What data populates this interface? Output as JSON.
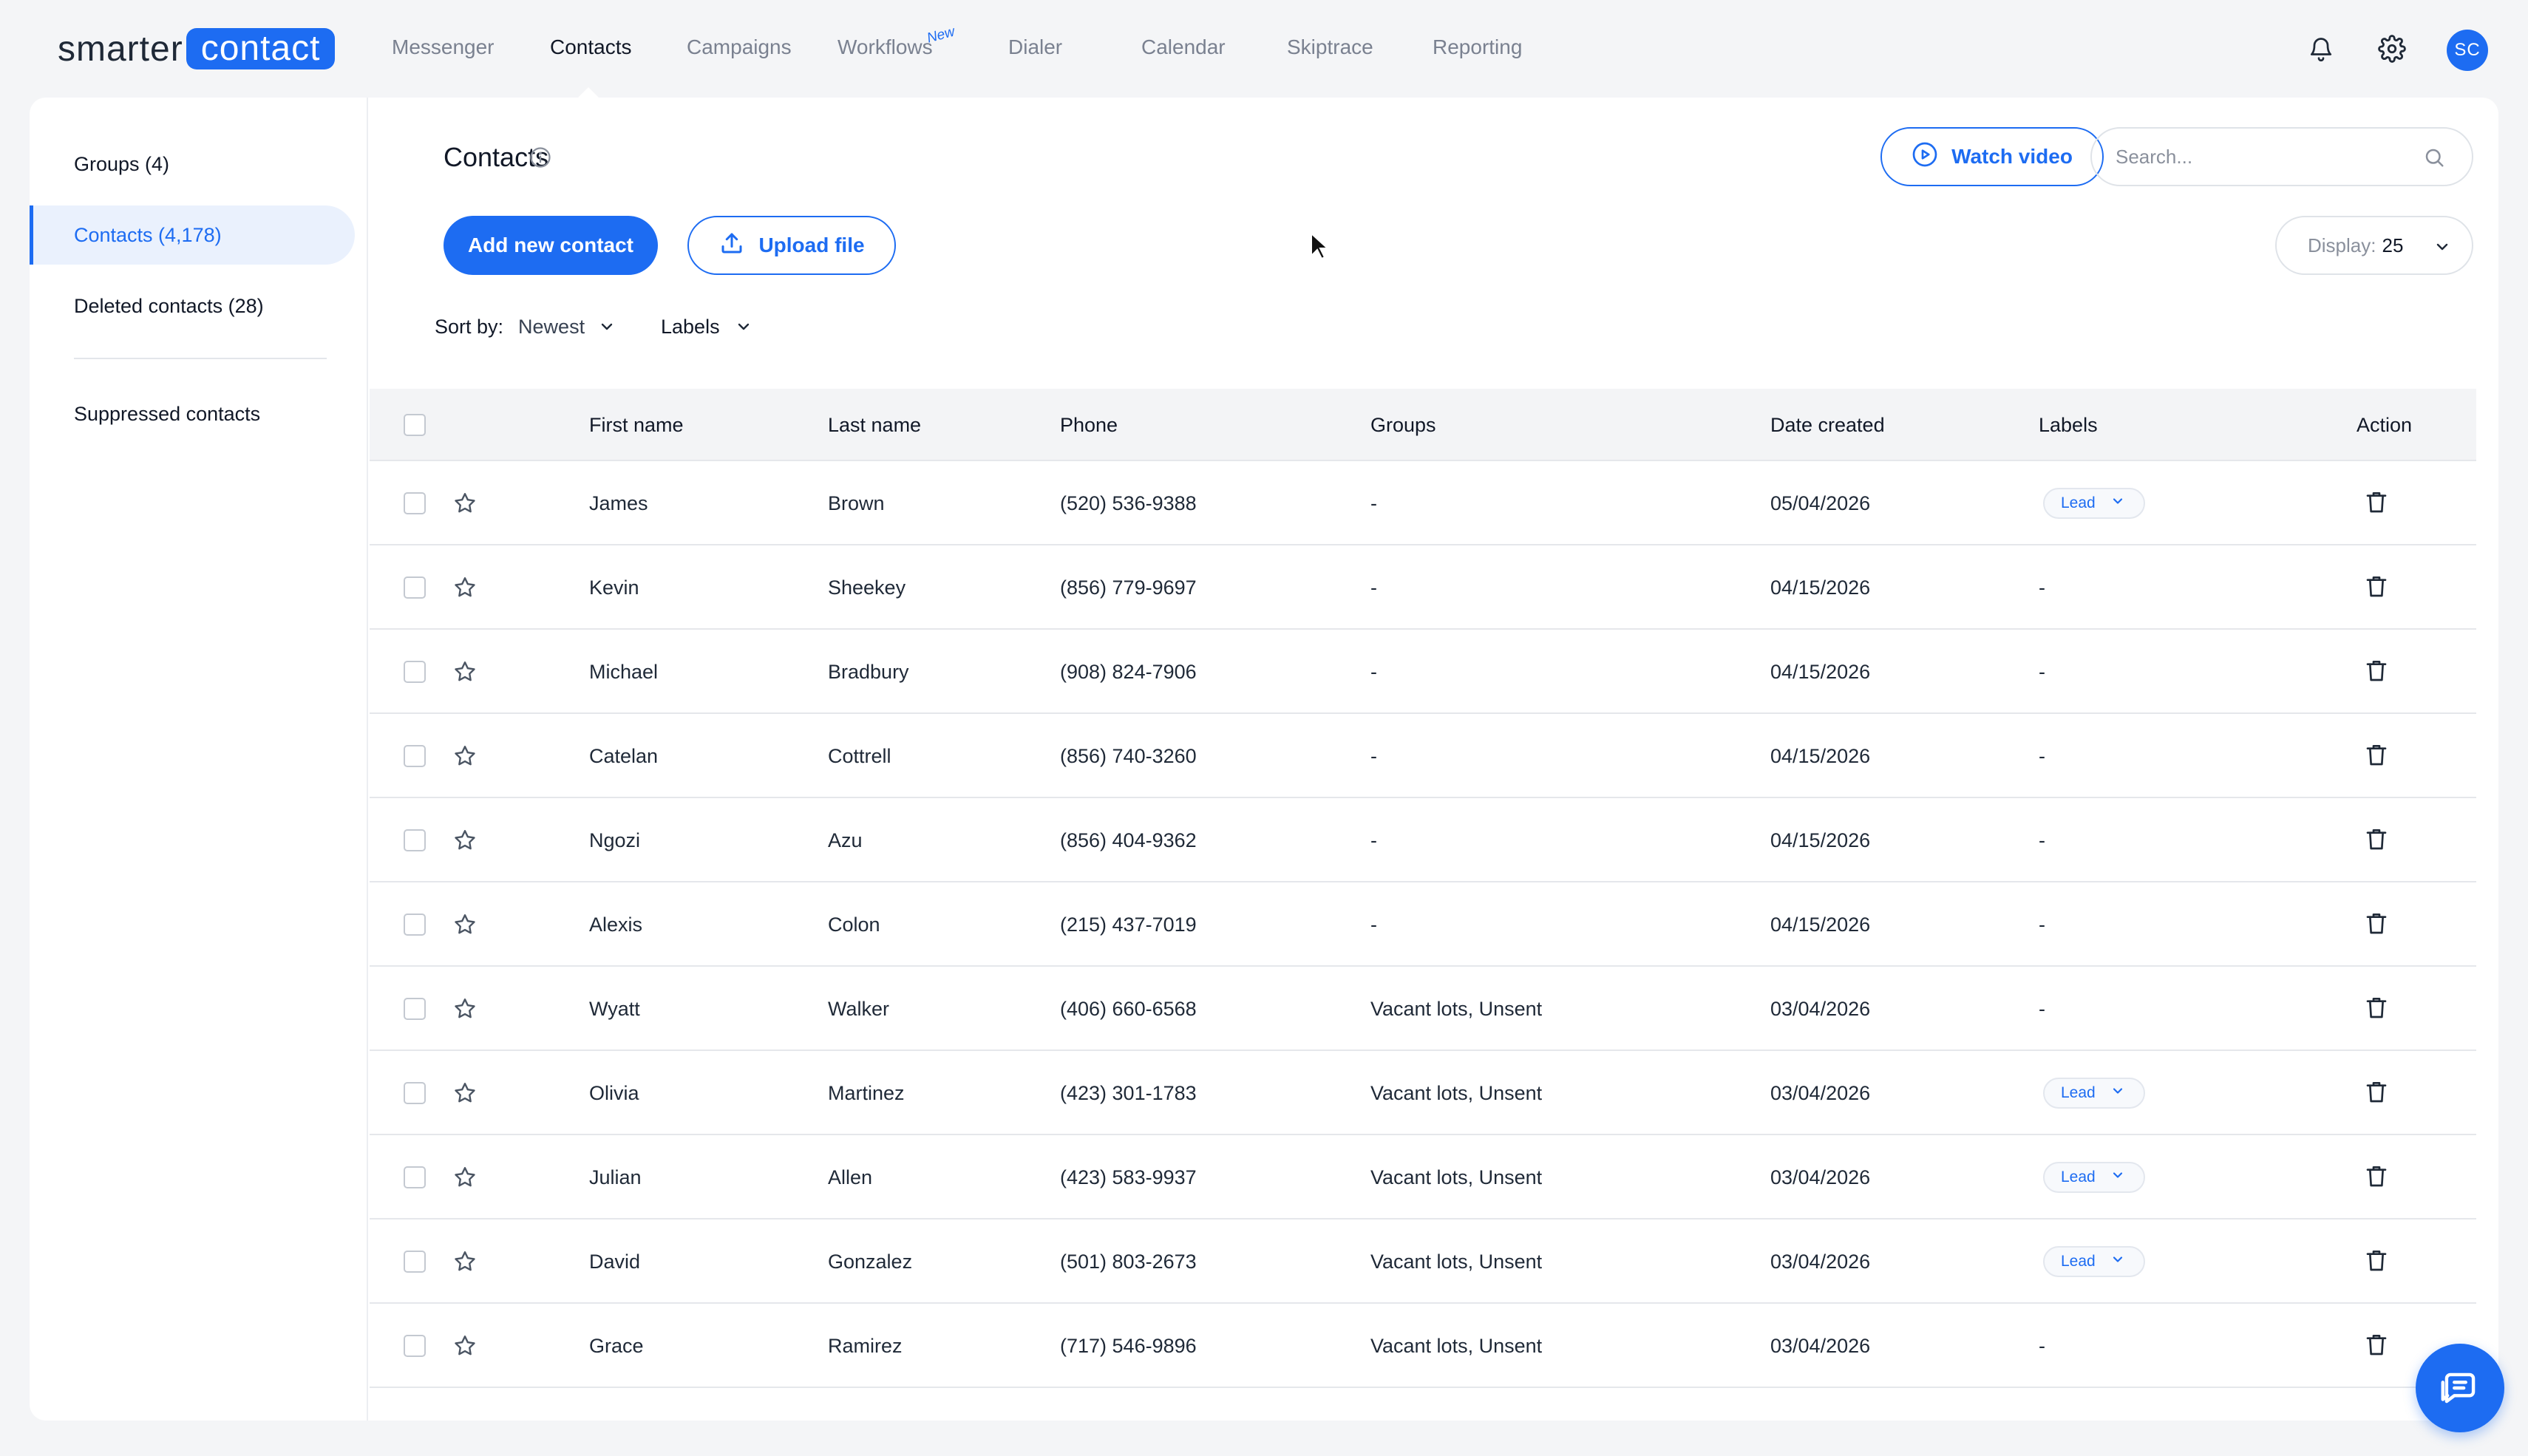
{
  "logo": {
    "part1": "smarter",
    "part2": "contact"
  },
  "nav": {
    "items": [
      "Messenger",
      "Contacts",
      "Campaigns",
      "Workflows",
      "Dialer",
      "Calendar",
      "Skiptrace",
      "Reporting"
    ],
    "active": "Contacts",
    "new_badge": "New"
  },
  "user": {
    "initials": "SC"
  },
  "sidebar": {
    "items": [
      {
        "label": "Groups (4)"
      },
      {
        "label": "Contacts (4,178)"
      },
      {
        "label": "Deleted contacts (28)"
      },
      {
        "label": "Suppressed contacts"
      }
    ],
    "active": "Contacts (4,178)"
  },
  "main": {
    "title": "Contacts",
    "watch_video": "Watch video",
    "search_placeholder": "Search...",
    "add_contact": "Add new contact",
    "upload_file": "Upload file",
    "display_label": "Display:",
    "display_value": "25",
    "sort_label": "Sort by:",
    "sort_value": "Newest",
    "labels_filter": "Labels"
  },
  "table": {
    "columns": [
      "First name",
      "Last name",
      "Phone",
      "Groups",
      "Date created",
      "Labels",
      "Action"
    ],
    "rows": [
      {
        "first": "James",
        "last": "Brown",
        "phone": "(520) 536-9388",
        "groups": "-",
        "date": "05/04/2026",
        "label": "Lead"
      },
      {
        "first": "Kevin",
        "last": "Sheekey",
        "phone": "(856) 779-9697",
        "groups": "-",
        "date": "04/15/2026",
        "label": "-"
      },
      {
        "first": "Michael",
        "last": "Bradbury",
        "phone": "(908) 824-7906",
        "groups": "-",
        "date": "04/15/2026",
        "label": "-"
      },
      {
        "first": "Catelan",
        "last": "Cottrell",
        "phone": "(856) 740-3260",
        "groups": "-",
        "date": "04/15/2026",
        "label": "-"
      },
      {
        "first": "Ngozi",
        "last": "Azu",
        "phone": "(856) 404-9362",
        "groups": "-",
        "date": "04/15/2026",
        "label": "-"
      },
      {
        "first": "Alexis",
        "last": "Colon",
        "phone": "(215) 437-7019",
        "groups": "-",
        "date": "04/15/2026",
        "label": "-"
      },
      {
        "first": "Wyatt",
        "last": "Walker",
        "phone": "(406) 660-6568",
        "groups": "Vacant lots, Unsent",
        "date": "03/04/2026",
        "label": "-"
      },
      {
        "first": "Olivia",
        "last": "Martinez",
        "phone": "(423) 301-1783",
        "groups": "Vacant lots, Unsent",
        "date": "03/04/2026",
        "label": "Lead"
      },
      {
        "first": "Julian",
        "last": "Allen",
        "phone": "(423) 583-9937",
        "groups": "Vacant lots, Unsent",
        "date": "03/04/2026",
        "label": "Lead"
      },
      {
        "first": "David",
        "last": "Gonzalez",
        "phone": "(501) 803-2673",
        "groups": "Vacant lots, Unsent",
        "date": "03/04/2026",
        "label": "Lead"
      },
      {
        "first": "Grace",
        "last": "Ramirez",
        "phone": "(717) 546-9896",
        "groups": "Vacant lots, Unsent",
        "date": "03/04/2026",
        "label": "-"
      }
    ]
  },
  "colors": {
    "accent": "#1d6cf2",
    "page_bg": "#f4f5f7",
    "header_bg": "#f3f4f6"
  },
  "icons": [
    "bell-icon",
    "gear-icon",
    "info-icon",
    "play-icon",
    "search-icon",
    "upload-icon",
    "chevron-down-icon",
    "star-icon",
    "trash-icon",
    "chat-icon"
  ]
}
